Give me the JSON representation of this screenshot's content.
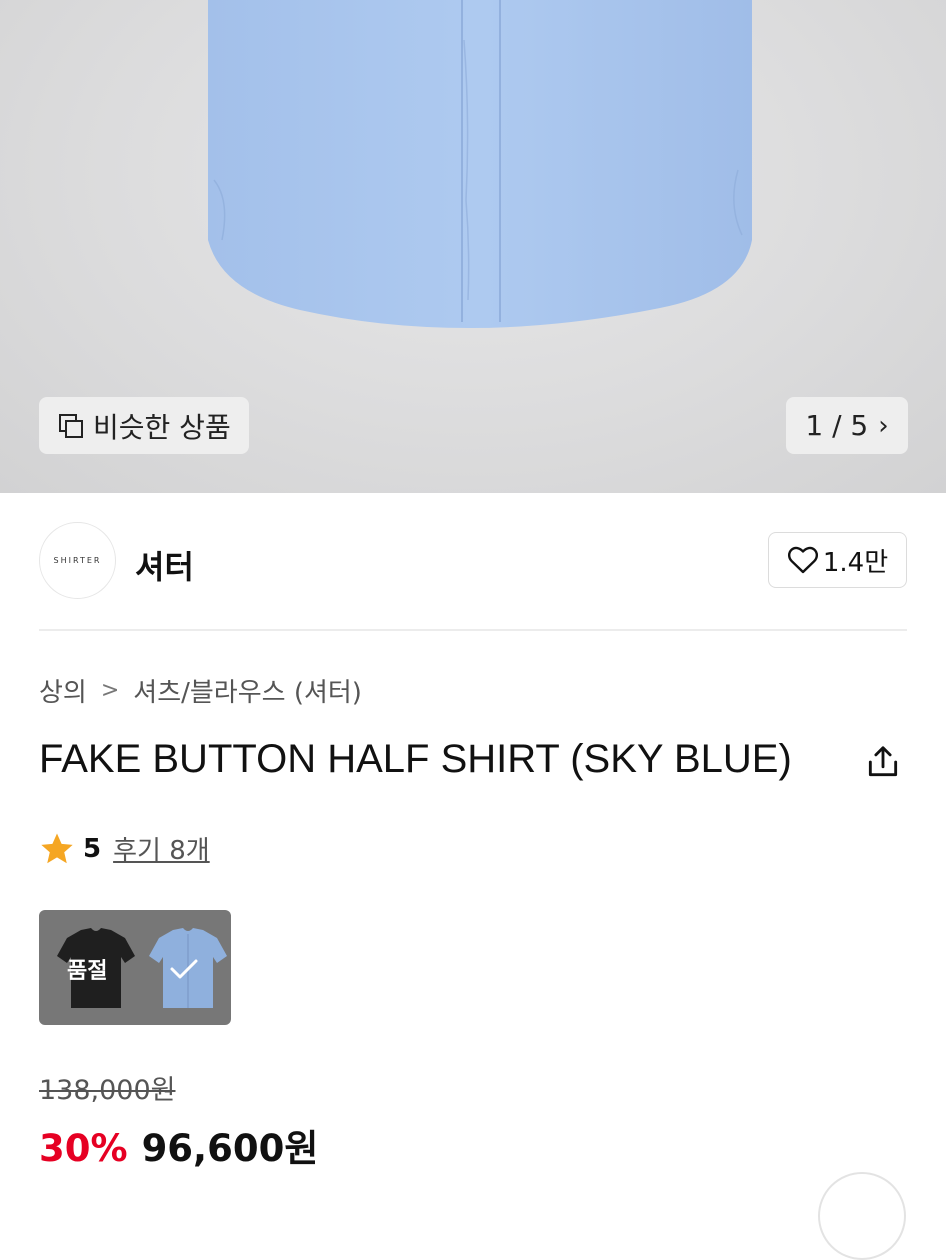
{
  "gallery": {
    "similar_label": "비슷한 상품",
    "counter": "1 / 5",
    "current_image": 1,
    "total_images": 5
  },
  "brand": {
    "logo_text": "SHIRTER",
    "name": "셔터",
    "likes": "1.4만"
  },
  "breadcrumb": {
    "category": "상의",
    "subcategory": "셔츠/블라우스 (셔터)"
  },
  "product": {
    "title": "FAKE BUTTON HALF SHIRT (SKY BLUE)",
    "rating": "5",
    "reviews": "후기 8개"
  },
  "options": {
    "colors": [
      {
        "color": "#1f1f1f",
        "status": "품절",
        "selected": false
      },
      {
        "color": "#8fb0dd",
        "status": "",
        "selected": true
      }
    ]
  },
  "price": {
    "original": "138,000원",
    "discount": "30%",
    "sale": "96,600원"
  },
  "colors": {
    "discount": "#e60023",
    "shirt": "#a9c6ee",
    "star": "#f5a623"
  }
}
